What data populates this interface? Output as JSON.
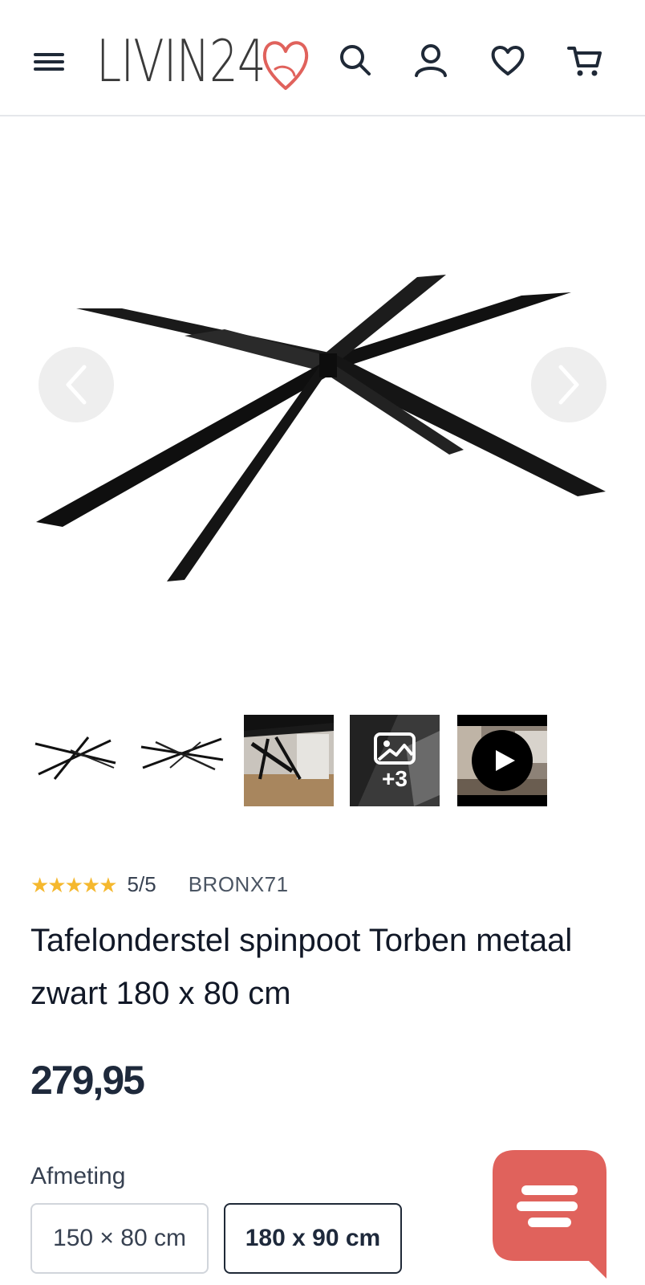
{
  "header": {
    "logo_text": "LIVIN24",
    "icons": [
      "menu-icon",
      "search-icon",
      "account-icon",
      "heart-icon",
      "cart-icon"
    ]
  },
  "gallery": {
    "prev_icon": "chevron-left-icon",
    "next_icon": "chevron-right-icon",
    "thumbnails": {
      "more_count": "+3"
    }
  },
  "product": {
    "rating_stars": "★★★★★",
    "rating": "5/5",
    "sku": "BRONX71",
    "title": "Tafelonderstel spinpoot Torben metaal zwart 180 x 80 cm",
    "price": "279,95"
  },
  "options": {
    "label": "Afmeting",
    "sizes": [
      "150 × 80 cm",
      "180 x 90 cm"
    ],
    "selected": "180 x 90 cm"
  },
  "colors": {
    "accent": "#e0625c",
    "star": "#f5b82e",
    "text": "#1e293b"
  }
}
